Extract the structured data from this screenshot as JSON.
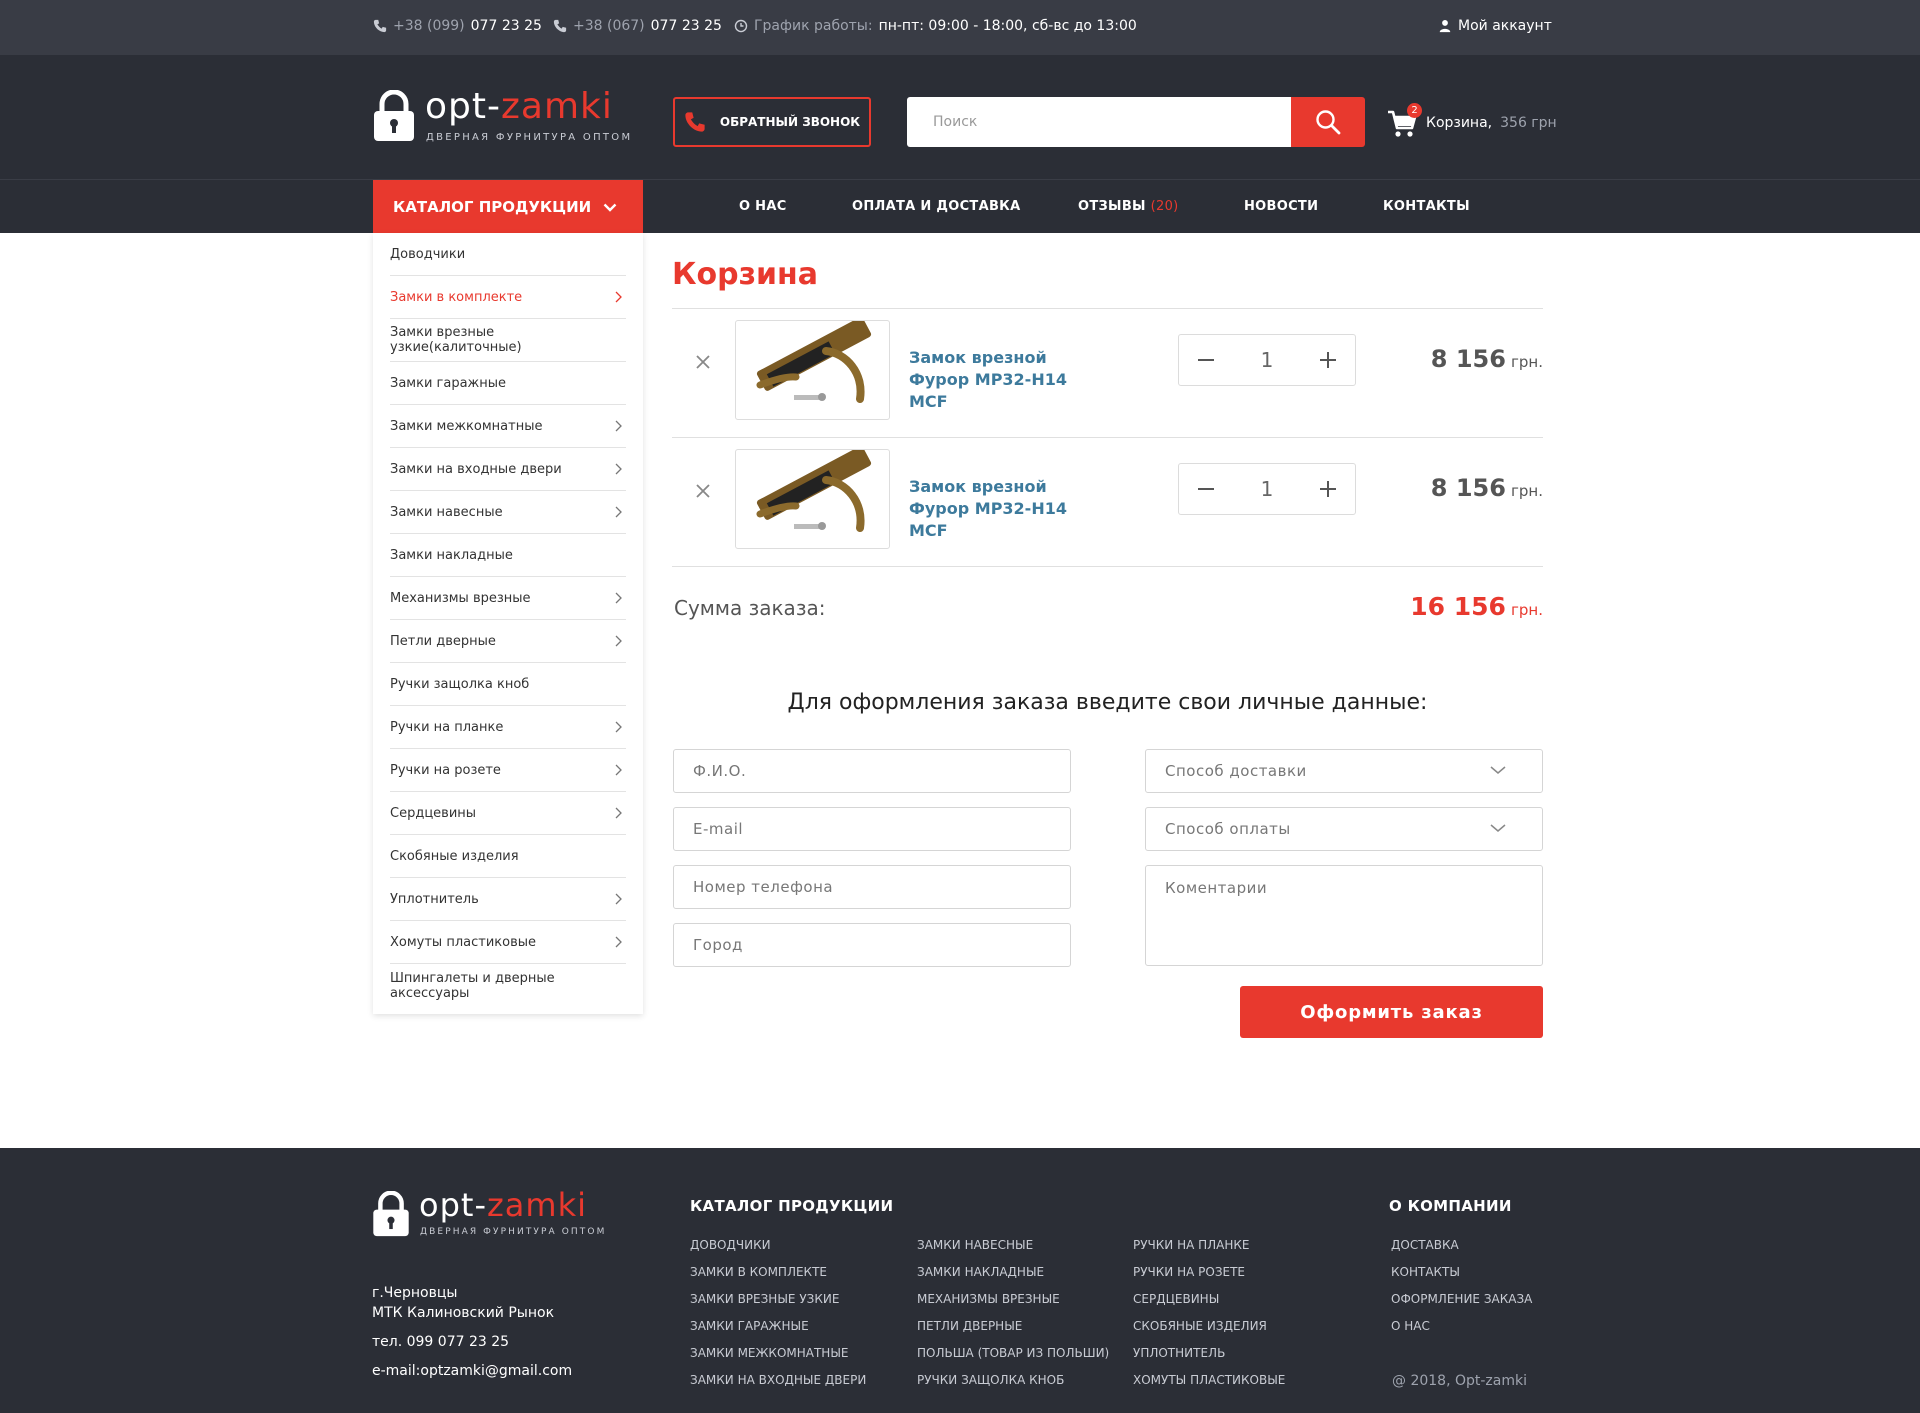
{
  "topbar": {
    "phone1_prefix": "+38 (099)",
    "phone1_number": "077 23 25",
    "phone2_prefix": "+38 (067)",
    "phone2_number": "077 23 25",
    "hours_label": "График работы:",
    "hours_value": "пн-пт: 09:00 - 18:00, сб-вс до 13:00",
    "account_label": "Мой аккаунт"
  },
  "brand": {
    "name_part1": "opt-",
    "name_part2": "zamki",
    "tagline": "ДВЕРНАЯ ФУРНИТУРА ОПТОМ",
    "accent_color": "#e8392e",
    "dark_bg": "#2b2e36"
  },
  "header": {
    "callback_label": "Обратный звонок",
    "search_placeholder": "Поиск",
    "cart_count": "2",
    "cart_label": "Корзина,",
    "cart_sum": "356 грн"
  },
  "nav": {
    "catalog_label": "Каталог продукции",
    "links": [
      {
        "label": "О нас"
      },
      {
        "label": "Оплата и доставка"
      },
      {
        "label": "Отзывы",
        "count": "(20)"
      },
      {
        "label": "Новости"
      },
      {
        "label": "Контакты"
      }
    ]
  },
  "sidebar": {
    "items": [
      {
        "label": "Доводчики",
        "arrow": false,
        "active": false
      },
      {
        "label": "Замки в комплекте",
        "arrow": true,
        "active": true
      },
      {
        "label": "Замки врезные узкие(калиточные)",
        "arrow": false,
        "active": false
      },
      {
        "label": "Замки гаражные",
        "arrow": false,
        "active": false
      },
      {
        "label": "Замки межкомнатные",
        "arrow": true,
        "active": false
      },
      {
        "label": "Замки на входные двери",
        "arrow": true,
        "active": false
      },
      {
        "label": "Замки навесные",
        "arrow": true,
        "active": false
      },
      {
        "label": "Замки накладные",
        "arrow": false,
        "active": false
      },
      {
        "label": "Механизмы врезные",
        "arrow": true,
        "active": false
      },
      {
        "label": "Петли дверные",
        "arrow": true,
        "active": false
      },
      {
        "label": "Ручки защолка кноб",
        "arrow": false,
        "active": false
      },
      {
        "label": "Ручки на планке",
        "arrow": true,
        "active": false
      },
      {
        "label": "Ручки на розете",
        "arrow": true,
        "active": false
      },
      {
        "label": "Сердцевины",
        "arrow": true,
        "active": false
      },
      {
        "label": "Скобяные изделия",
        "arrow": false,
        "active": false
      },
      {
        "label": "Уплотнитель",
        "arrow": true,
        "active": false
      },
      {
        "label": "Хомуты пластиковые",
        "arrow": true,
        "active": false
      },
      {
        "label": "Шпингалеты и дверные аксессуары",
        "arrow": false,
        "active": false
      }
    ]
  },
  "cart": {
    "title": "Корзина",
    "items": [
      {
        "name": "Замок врезной Фурор МР32-Н14 MCF",
        "qty": "1",
        "price": "8 156",
        "currency": "грн."
      },
      {
        "name": "Замок врезной Фурор МР32-Н14 MCF",
        "qty": "1",
        "price": "8 156",
        "currency": "грн."
      }
    ],
    "total_label": "Сумма заказа:",
    "total_value": "16 156",
    "total_currency": "грн."
  },
  "order_form": {
    "title": "Для оформления заказа введите свои личные данные:",
    "name_placeholder": "Ф.И.О.",
    "email_placeholder": "E-mail",
    "phone_placeholder": "Номер телефона",
    "city_placeholder": "Город",
    "delivery_placeholder": "Способ доставки",
    "payment_placeholder": "Способ оплаты",
    "comment_placeholder": "Коментарии",
    "submit_label": "Оформить заказ"
  },
  "footer": {
    "address_line1": "г.Черновцы",
    "address_line2": "МТК Калиновский Рынок",
    "phone": "тел. 099 077 23 25",
    "email": "e-mail:optzamki@gmail.com",
    "catalog_heading": "Каталог продукции",
    "catalog_col1": [
      "Доводчики",
      "Замки в комплекте",
      "Замки врезные узкие",
      "Замки гаражные",
      "Замки межкомнатные",
      "Замки на входные двери"
    ],
    "catalog_col2": [
      "Замки навесные",
      "Замки накладные",
      "Механизмы врезные",
      "Петли дверные",
      "ПОЛЬША (товар из Польши)",
      "Ручки защолка кноб"
    ],
    "catalog_col3": [
      "Ручки на планке",
      "Ручки на розете",
      "Сердцевины",
      "Скобяные изделия",
      "Уплотнитель",
      "Хомуты пластиковые"
    ],
    "company_heading": "О компании",
    "company_links": [
      "Доставка",
      "Контакты",
      "Оформление заказа",
      "О нас"
    ],
    "copyright": "@ 2018, Opt-zamki"
  }
}
